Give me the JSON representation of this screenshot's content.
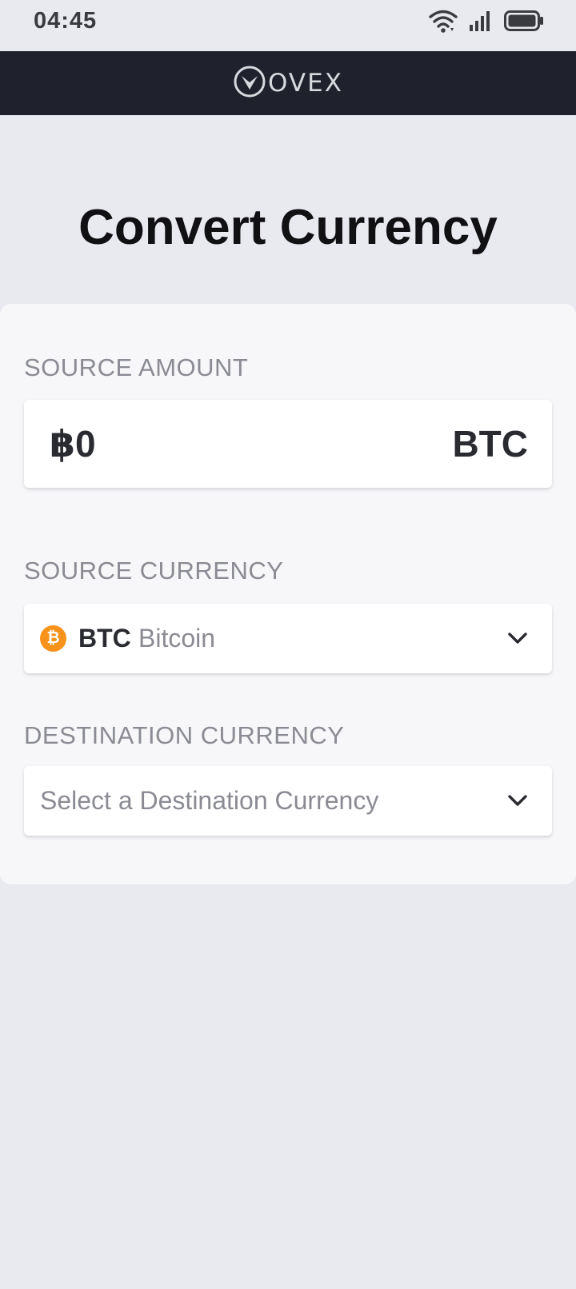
{
  "status_bar": {
    "time": "04:45",
    "icons": [
      "wifi-icon",
      "signal-icon",
      "battery-icon"
    ]
  },
  "header": {
    "logo_text": "OVEX",
    "logo_icon": "ovex-logo-icon"
  },
  "page": {
    "title": "Convert Currency"
  },
  "source_amount": {
    "label": "SOURCE AMOUNT",
    "value": "฿0",
    "unit": "BTC"
  },
  "source_currency": {
    "label": "SOURCE CURRENCY",
    "icon_glyph": "₿",
    "code": "BTC",
    "name": "Bitcoin",
    "icon": "bitcoin-icon"
  },
  "destination_currency": {
    "label": "DESTINATION CURRENCY",
    "placeholder": "Select a Destination Currency"
  },
  "colors": {
    "header_bg": "#1f222d",
    "page_bg": "#e9eaef",
    "card_bg": "#f7f7fa",
    "bitcoin_orange": "#f7931a",
    "label_gray": "#8a8b93"
  }
}
